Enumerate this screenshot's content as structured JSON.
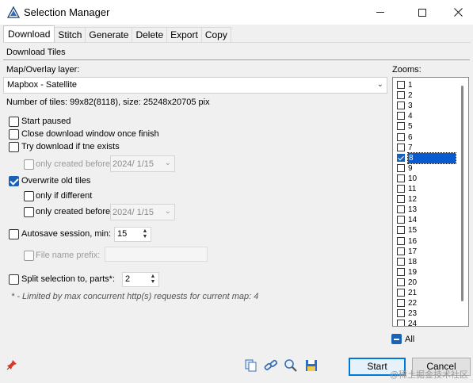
{
  "window": {
    "title": "Selection Manager"
  },
  "tabs": [
    "Download",
    "Stitch",
    "Generate",
    "Delete",
    "Export",
    "Copy"
  ],
  "section": {
    "title": "Download Tiles"
  },
  "layer": {
    "label": "Map/Overlay layer:",
    "value": "Mapbox - Satellite"
  },
  "tiles_info": "Number of tiles: 99x82(8118), size: 25248x20705 pix",
  "options": {
    "start_paused": "Start paused",
    "close_on_finish": "Close download window once finish",
    "try_if_exists": "Try download if tne exists",
    "only_created_before_1": "only created before",
    "date_1": "2024/  1/15",
    "overwrite_old": "Overwrite old tiles",
    "only_if_different": "only if different",
    "only_created_before_2": "only created before",
    "date_2": "2024/  1/15",
    "autosave": "Autosave session, min:",
    "autosave_value": "15",
    "file_name_prefix": "File name prefix:",
    "split_selection": "Split selection to, parts*:",
    "split_value": "2"
  },
  "note": "* - Limited by max concurrent http(s) requests for current map: 4",
  "zooms": {
    "label": "Zooms:",
    "levels": [
      "1",
      "2",
      "3",
      "4",
      "5",
      "6",
      "7",
      "8",
      "9",
      "10",
      "11",
      "12",
      "13",
      "14",
      "15",
      "16",
      "17",
      "18",
      "19",
      "20",
      "21",
      "22",
      "23",
      "24"
    ],
    "checked": "8",
    "all_label": "All"
  },
  "buttons": {
    "start": "Start",
    "cancel": "Cancel"
  },
  "watermark": "@稀土掘金技术社区",
  "colors": {
    "accent": "#0078d7",
    "selection": "#0a5ad0"
  }
}
